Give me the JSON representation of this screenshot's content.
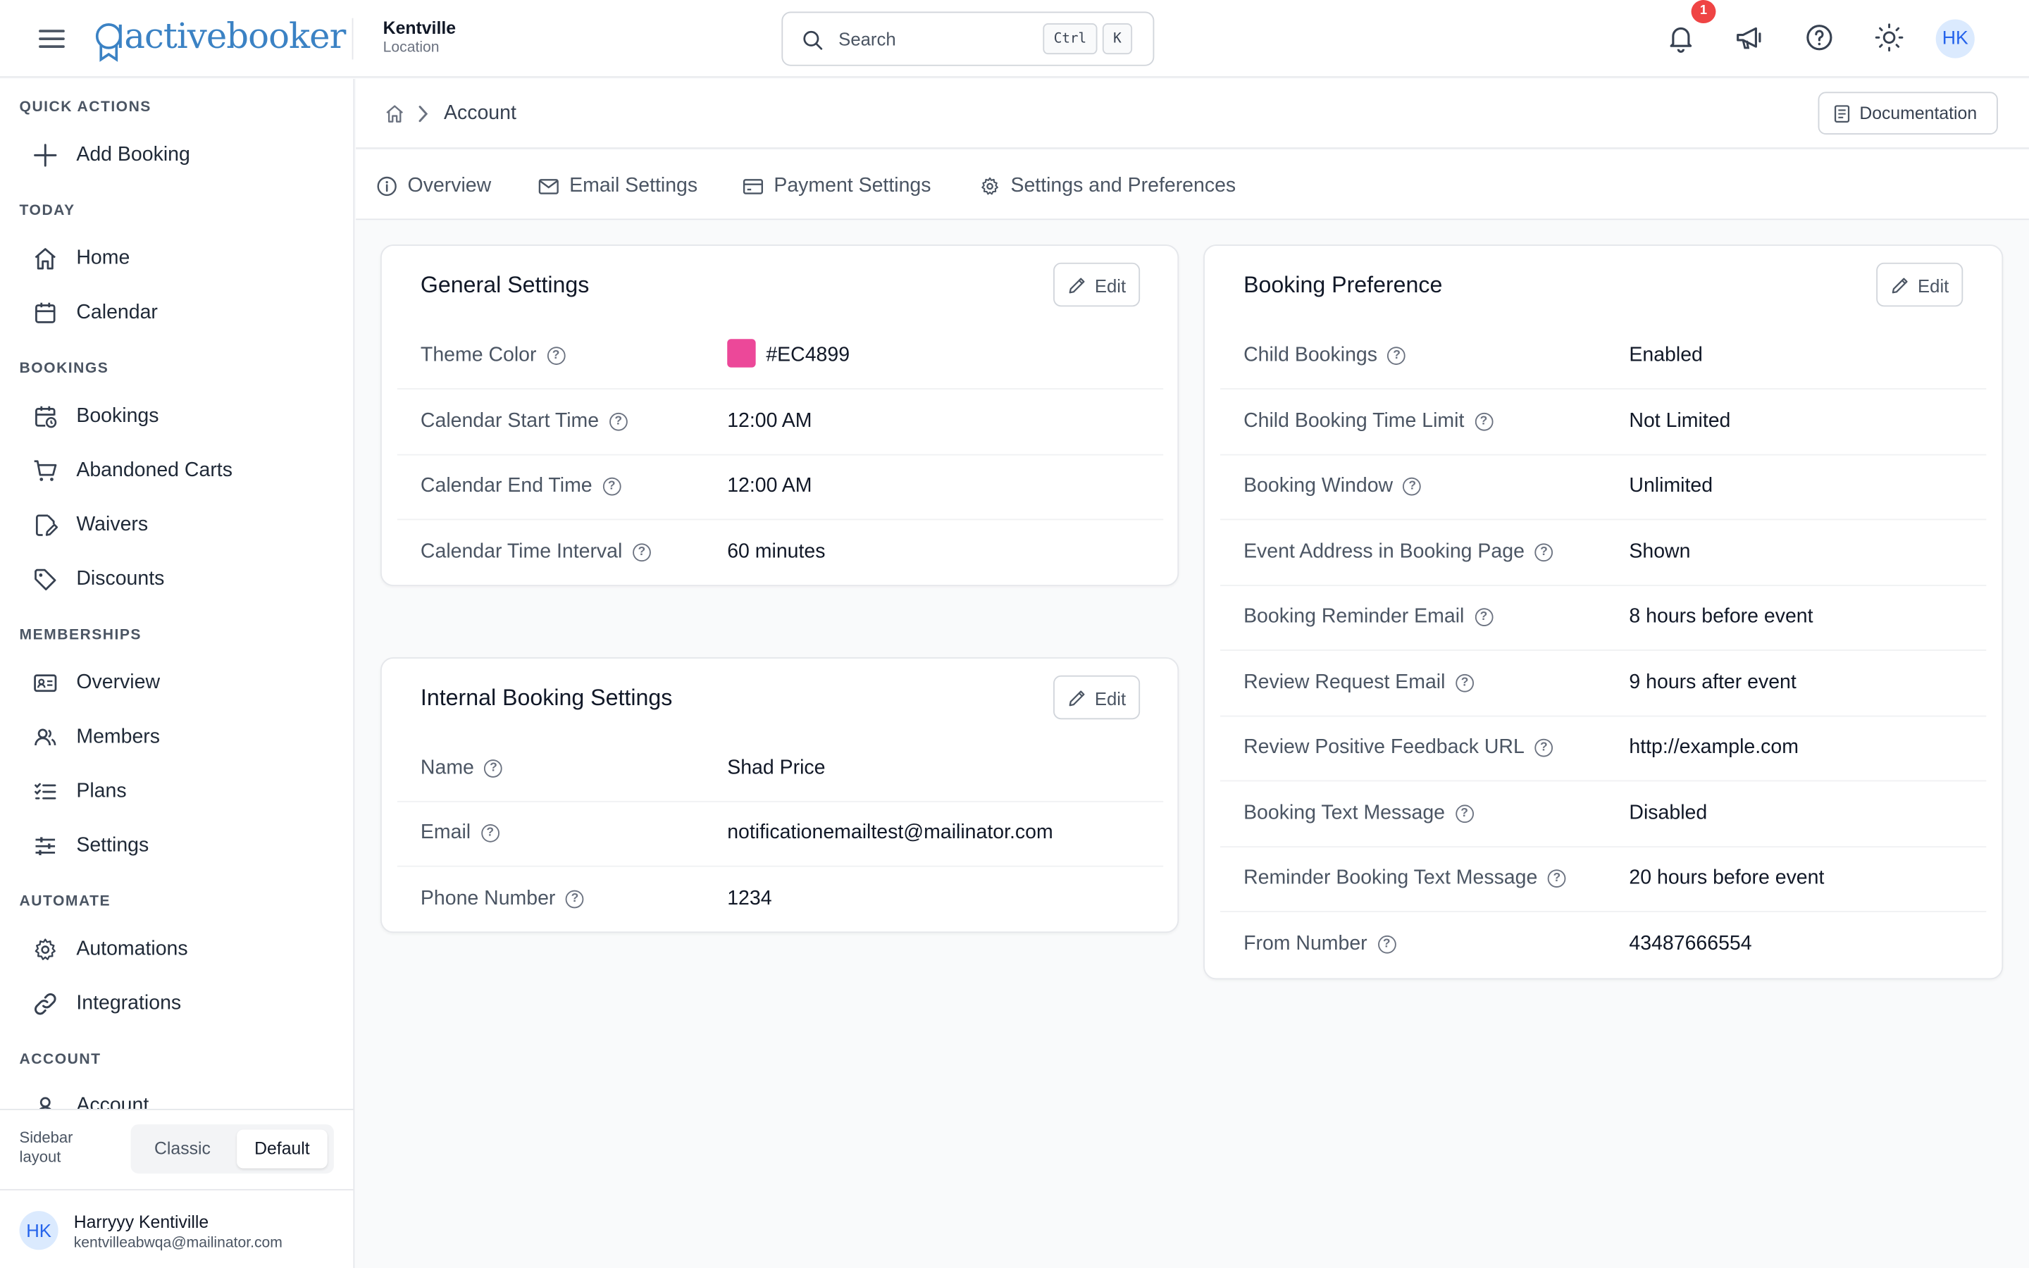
{
  "brand": {
    "logo_text": "activebooker"
  },
  "location": {
    "name": "Kentville",
    "subtitle": "Location"
  },
  "search": {
    "placeholder": "Search",
    "shortcut_ctrl": "Ctrl",
    "shortcut_key": "K"
  },
  "topbar": {
    "notification_count": "1",
    "avatar_initials": "HK"
  },
  "sidebar": {
    "sections": {
      "quick_actions": "QUICK ACTIONS",
      "today": "TODAY",
      "bookings": "BOOKINGS",
      "memberships": "MEMBERSHIPS",
      "automate": "AUTOMATE",
      "account": "ACCOUNT"
    },
    "items": {
      "add_booking": "Add Booking",
      "home": "Home",
      "calendar": "Calendar",
      "bookings": "Bookings",
      "abandoned_carts": "Abandoned Carts",
      "waivers": "Waivers",
      "discounts": "Discounts",
      "overview": "Overview",
      "members": "Members",
      "plans": "Plans",
      "settings": "Settings",
      "automations": "Automations",
      "integrations": "Integrations",
      "account": "Account"
    },
    "layout_label": "Sidebar layout",
    "layout_options": {
      "classic": "Classic",
      "default": "Default"
    },
    "layout_selected": "Default",
    "user": {
      "initials": "HK",
      "name": "Harryyy Kentiville",
      "email": "kentvilleabwqa@mailinator.com"
    }
  },
  "breadcrumb": {
    "current": "Account"
  },
  "documentation_label": "Documentation",
  "tabs": {
    "overview": "Overview",
    "email_settings": "Email Settings",
    "payment_settings": "Payment Settings",
    "settings_preferences": "Settings and Preferences"
  },
  "general_settings": {
    "title": "General Settings",
    "edit_label": "Edit",
    "rows": [
      {
        "label": "Theme Color",
        "value": "#EC4899",
        "color": "#EC4899"
      },
      {
        "label": "Calendar Start Time",
        "value": "12:00 AM"
      },
      {
        "label": "Calendar End Time",
        "value": "12:00 AM"
      },
      {
        "label": "Calendar Time Interval",
        "value": "60 minutes"
      }
    ]
  },
  "internal_booking": {
    "title": "Internal Booking Settings",
    "edit_label": "Edit",
    "rows": [
      {
        "label": "Name",
        "value": "Shad Price"
      },
      {
        "label": "Email",
        "value": "notificationemailtest@mailinator.com"
      },
      {
        "label": "Phone Number",
        "value": "1234"
      }
    ]
  },
  "booking_preference": {
    "title": "Booking Preference",
    "edit_label": "Edit",
    "rows": [
      {
        "label": "Child Bookings",
        "value": "Enabled"
      },
      {
        "label": "Child Booking Time Limit",
        "value": "Not Limited"
      },
      {
        "label": "Booking Window",
        "value": "Unlimited"
      },
      {
        "label": "Event Address in Booking Page",
        "value": "Shown"
      },
      {
        "label": "Booking Reminder Email",
        "value": "8 hours before event"
      },
      {
        "label": "Review Request Email",
        "value": "9 hours after event"
      },
      {
        "label": "Review Positive Feedback URL",
        "value": "http://example.com"
      },
      {
        "label": "Booking Text Message",
        "value": "Disabled"
      },
      {
        "label": "Reminder Booking Text Message",
        "value": "20 hours before event"
      },
      {
        "label": "From Number",
        "value": "43487666554"
      }
    ]
  }
}
